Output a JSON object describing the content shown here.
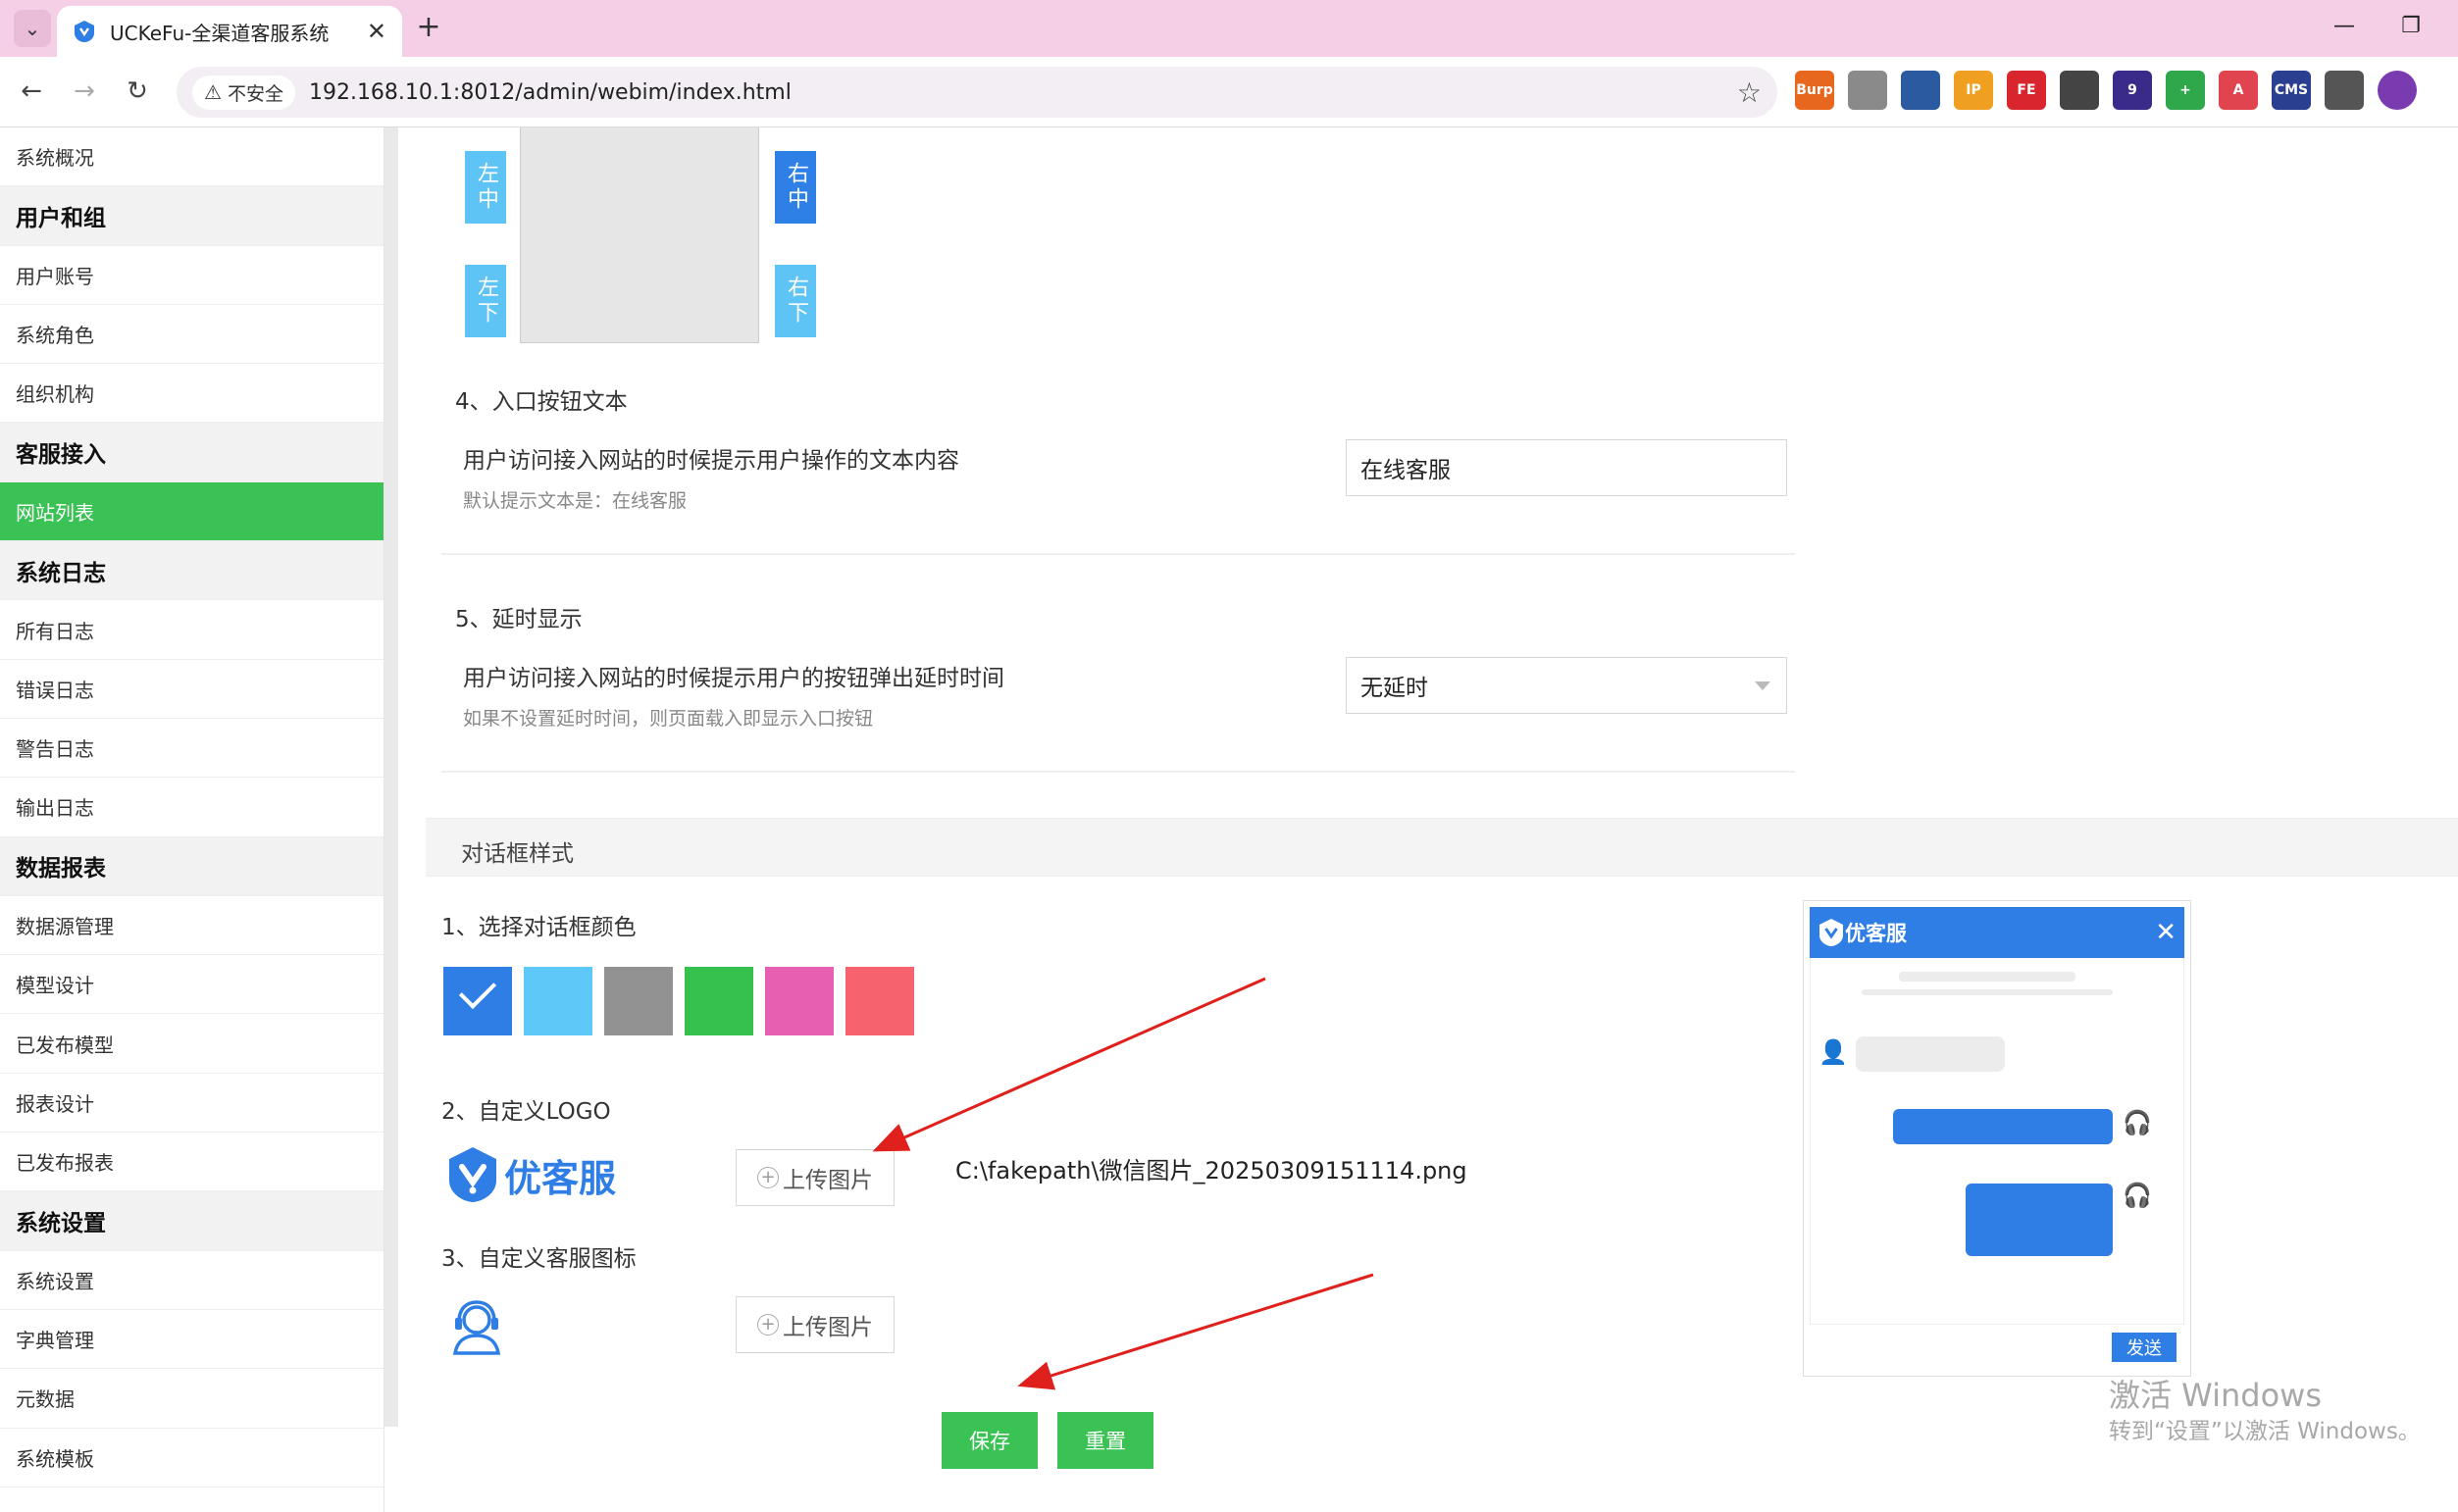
{
  "browser": {
    "tab_title": "UCKeFu-全渠道客服系统",
    "new_tab": "+",
    "security_label": "不安全",
    "url": "192.168.10.1:8012/admin/webim/index.html",
    "extensions": [
      {
        "name": "burp-extension-icon",
        "label": "Burp",
        "color": "#e8671f"
      },
      {
        "name": "link-extension-icon",
        "label": "",
        "color": "#8a8a8a"
      },
      {
        "name": "shield-extension-icon",
        "label": "",
        "color": "#2c5aa0"
      },
      {
        "name": "ip-extension-icon",
        "label": "IP",
        "color": "#f0a020"
      },
      {
        "name": "fe-extension-icon",
        "label": "FE",
        "color": "#d9262e"
      },
      {
        "name": "qr-extension-icon",
        "label": "",
        "color": "#444444"
      },
      {
        "name": "hat-extension-icon",
        "label": "9",
        "color": "#3a2a8a"
      },
      {
        "name": "plus-extension-icon",
        "label": "+",
        "color": "#2ea84a"
      },
      {
        "name": "translate-extension-icon",
        "label": "A",
        "color": "#e0454f"
      },
      {
        "name": "cms-extension-icon",
        "label": "CMS",
        "color": "#2a3f8f"
      },
      {
        "name": "puzzle-extension-icon",
        "label": "",
        "color": "#555555"
      },
      {
        "name": "profile-avatar-icon",
        "label": "",
        "color": "#7a3ab0"
      }
    ]
  },
  "sidebar": {
    "items": [
      {
        "label": "系统概况",
        "type": "item"
      },
      {
        "label": "用户和组",
        "type": "group"
      },
      {
        "label": "用户账号",
        "type": "item"
      },
      {
        "label": "系统角色",
        "type": "item"
      },
      {
        "label": "组织机构",
        "type": "item"
      },
      {
        "label": "客服接入",
        "type": "group"
      },
      {
        "label": "网站列表",
        "type": "active"
      },
      {
        "label": "系统日志",
        "type": "group"
      },
      {
        "label": "所有日志",
        "type": "item"
      },
      {
        "label": "错误日志",
        "type": "item"
      },
      {
        "label": "警告日志",
        "type": "item"
      },
      {
        "label": "输出日志",
        "type": "item"
      },
      {
        "label": "数据报表",
        "type": "group"
      },
      {
        "label": "数据源管理",
        "type": "item"
      },
      {
        "label": "模型设计",
        "type": "item"
      },
      {
        "label": "已发布模型",
        "type": "item"
      },
      {
        "label": "报表设计",
        "type": "item"
      },
      {
        "label": "已发布报表",
        "type": "item"
      },
      {
        "label": "系统设置",
        "type": "group"
      },
      {
        "label": "系统设置",
        "type": "item"
      },
      {
        "label": "字典管理",
        "type": "item"
      },
      {
        "label": "元数据",
        "type": "item"
      },
      {
        "label": "系统模板",
        "type": "item"
      }
    ]
  },
  "position": {
    "left_mid": "左中",
    "left_bottom": "左下",
    "right_mid": "右中",
    "right_bottom": "右下"
  },
  "entry_text": {
    "title": "4、入口按钮文本",
    "desc": "用户访问接入网站的时候提示用户操作的文本内容",
    "hint": "默认提示文本是：在线客服",
    "value": "在线客服"
  },
  "delay": {
    "title": "5、延时显示",
    "desc": "用户访问接入网站的时候提示用户的按钮弹出延时时间",
    "hint": "如果不设置延时时间，则页面载入即显示入口按钮",
    "value": "无延时"
  },
  "dialog_style": {
    "band_title": "对话框样式",
    "color_title": "1、选择对话框颜色",
    "colors": [
      "#2f7ee6",
      "#5ec9f8",
      "#929292",
      "#36c14f",
      "#e65fb0",
      "#f6626e"
    ],
    "selected_color_index": 0,
    "logo_title": "2、自定义LOGO",
    "logo_text": "优客服",
    "logo_upload": "上传图片",
    "logo_file": "C:\\fakepath\\微信图片_20250309151114.png",
    "icon_title": "3、自定义客服图标",
    "icon_upload": "上传图片"
  },
  "actions": {
    "save": "保存",
    "reset": "重置"
  },
  "chat_preview": {
    "title": "优客服",
    "send": "发送"
  },
  "watermark": {
    "line1": "激活 Windows",
    "line2": "转到“设置”以激活 Windows。"
  }
}
